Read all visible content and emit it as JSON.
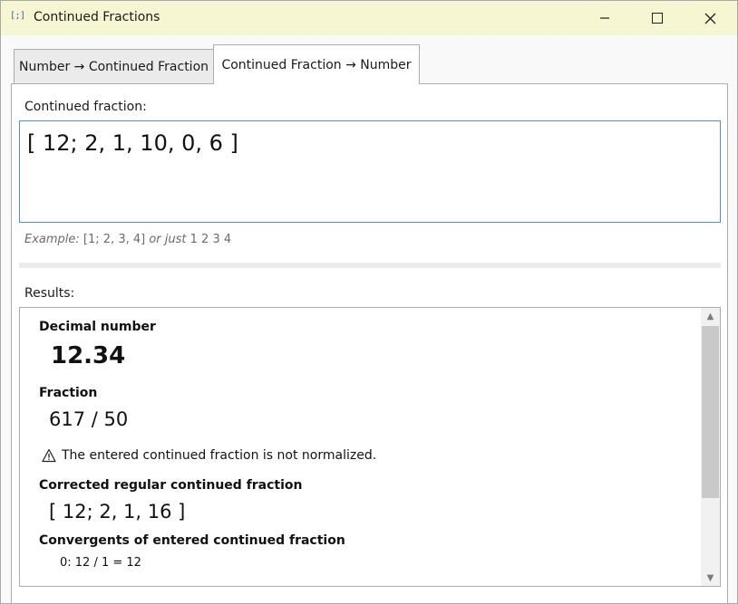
{
  "window": {
    "icon_text": "[;]",
    "title": "Continued Fractions"
  },
  "tabs": [
    {
      "label": "Number → Continued Fraction",
      "active": false
    },
    {
      "label": "Continued Fraction → Number",
      "active": true
    }
  ],
  "input": {
    "label": "Continued fraction:",
    "value": "[ 12; 2, 1, 10, 0, 6 ]",
    "example_prefix": "Example:",
    "example_a": "[1; 2, 3, 4]",
    "example_mid": "or just",
    "example_b": "1 2 3 4"
  },
  "results": {
    "label": "Results:",
    "decimal_heading": "Decimal number",
    "decimal_value": "12.34",
    "fraction_heading": "Fraction",
    "fraction_value": "617 / 50",
    "warning": "The entered continued fraction is not normalized.",
    "corrected_heading": "Corrected regular continued fraction",
    "corrected_value": "[ 12; 2, 1, 16 ]",
    "convergents_heading": "Convergents of entered continued fraction",
    "convergents": [
      "0:  12 / 1 = 12"
    ]
  },
  "colors": {
    "titlebar": "#f6f6d2",
    "input_border": "#4a90d9"
  }
}
